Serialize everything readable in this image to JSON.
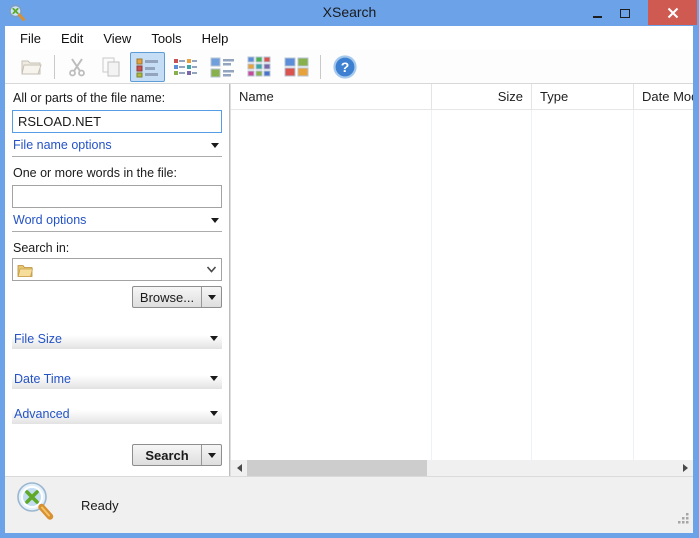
{
  "window": {
    "title": "XSearch"
  },
  "menu": {
    "items": [
      "File",
      "Edit",
      "View",
      "Tools",
      "Help"
    ]
  },
  "toolbar": {
    "icons": [
      "open-folder",
      "cut",
      "copy",
      "details-view",
      "small-icons-view",
      "list-view",
      "icons-view",
      "tiles-view",
      "help"
    ],
    "selected_icon": "details-view",
    "disabled_icons": [
      "open-folder",
      "cut",
      "copy"
    ]
  },
  "search_panel": {
    "file_name_label": "All or parts of the file name:",
    "file_name_value": "RSLOAD.NET",
    "file_name_options_label": "File name options",
    "words_label": "One or more words in the file:",
    "words_value": "",
    "word_options_label": "Word options",
    "search_in_label": "Search in:",
    "search_in_value": "",
    "browse_label": "Browse...",
    "sections": [
      {
        "label": "File Size"
      },
      {
        "label": "Date Time"
      },
      {
        "label": "Advanced"
      }
    ],
    "search_button_label": "Search"
  },
  "list": {
    "columns": [
      {
        "label": "Name",
        "align": "left"
      },
      {
        "label": "Size",
        "align": "right"
      },
      {
        "label": "Type",
        "align": "left"
      },
      {
        "label": "Date Modified",
        "align": "left"
      }
    ],
    "rows": []
  },
  "status": {
    "text": "Ready"
  },
  "colors": {
    "titlebar": "#6CA2E8",
    "close_button": "#CE5A52",
    "link_text": "#2453C6",
    "selected_tool_bg": "#C6DEF5",
    "selected_tool_border": "#5E9CD6"
  }
}
